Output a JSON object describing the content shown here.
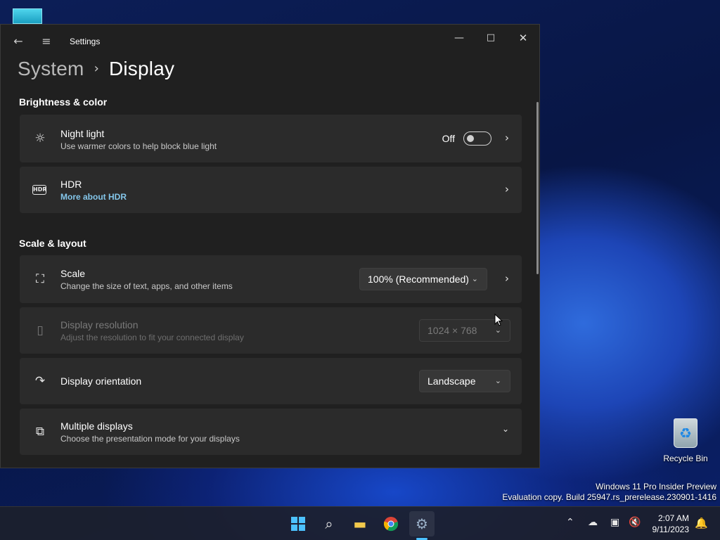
{
  "window": {
    "title": "Settings",
    "min_glyph": "—",
    "max_glyph": "□",
    "close_glyph": "✕"
  },
  "breadcrumb": {
    "parent": "System",
    "separator": "›",
    "current": "Display"
  },
  "sections": {
    "brightness": "Brightness & color",
    "scale_layout": "Scale & layout"
  },
  "night_light": {
    "title": "Night light",
    "desc": "Use warmer colors to help block blue light",
    "state": "Off",
    "icon": "sun-icon"
  },
  "hdr": {
    "title": "HDR",
    "link": "More about HDR",
    "icon": "hdr-icon"
  },
  "scale": {
    "title": "Scale",
    "desc": "Change the size of text, apps, and other items",
    "value": "100% (Recommended)",
    "icon": "scale-icon"
  },
  "resolution": {
    "title": "Display resolution",
    "desc": "Adjust the resolution to fit your connected display",
    "value": "1024 × 768",
    "icon": "resolution-icon"
  },
  "orientation": {
    "title": "Display orientation",
    "value": "Landscape",
    "icon": "orientation-icon"
  },
  "multiple": {
    "title": "Multiple displays",
    "desc": "Choose the presentation mode for your displays",
    "icon": "multiple-displays-icon"
  },
  "desktop": {
    "recycle_bin": "Recycle Bin"
  },
  "watermark": {
    "line1": "Windows 11 Pro Insider Preview",
    "line2": "Evaluation copy. Build 25947.rs_prerelease.230901-1416"
  },
  "taskbar": {
    "time": "2:07 AM",
    "date": "9/11/2023",
    "apps": [
      "start-icon",
      "search-icon",
      "file-explorer-icon",
      "chrome-icon",
      "settings-icon"
    ]
  },
  "colors": {
    "accent": "#4cc2ff",
    "link": "#84c6ea",
    "card": "#2b2b2b",
    "window": "#202020"
  }
}
